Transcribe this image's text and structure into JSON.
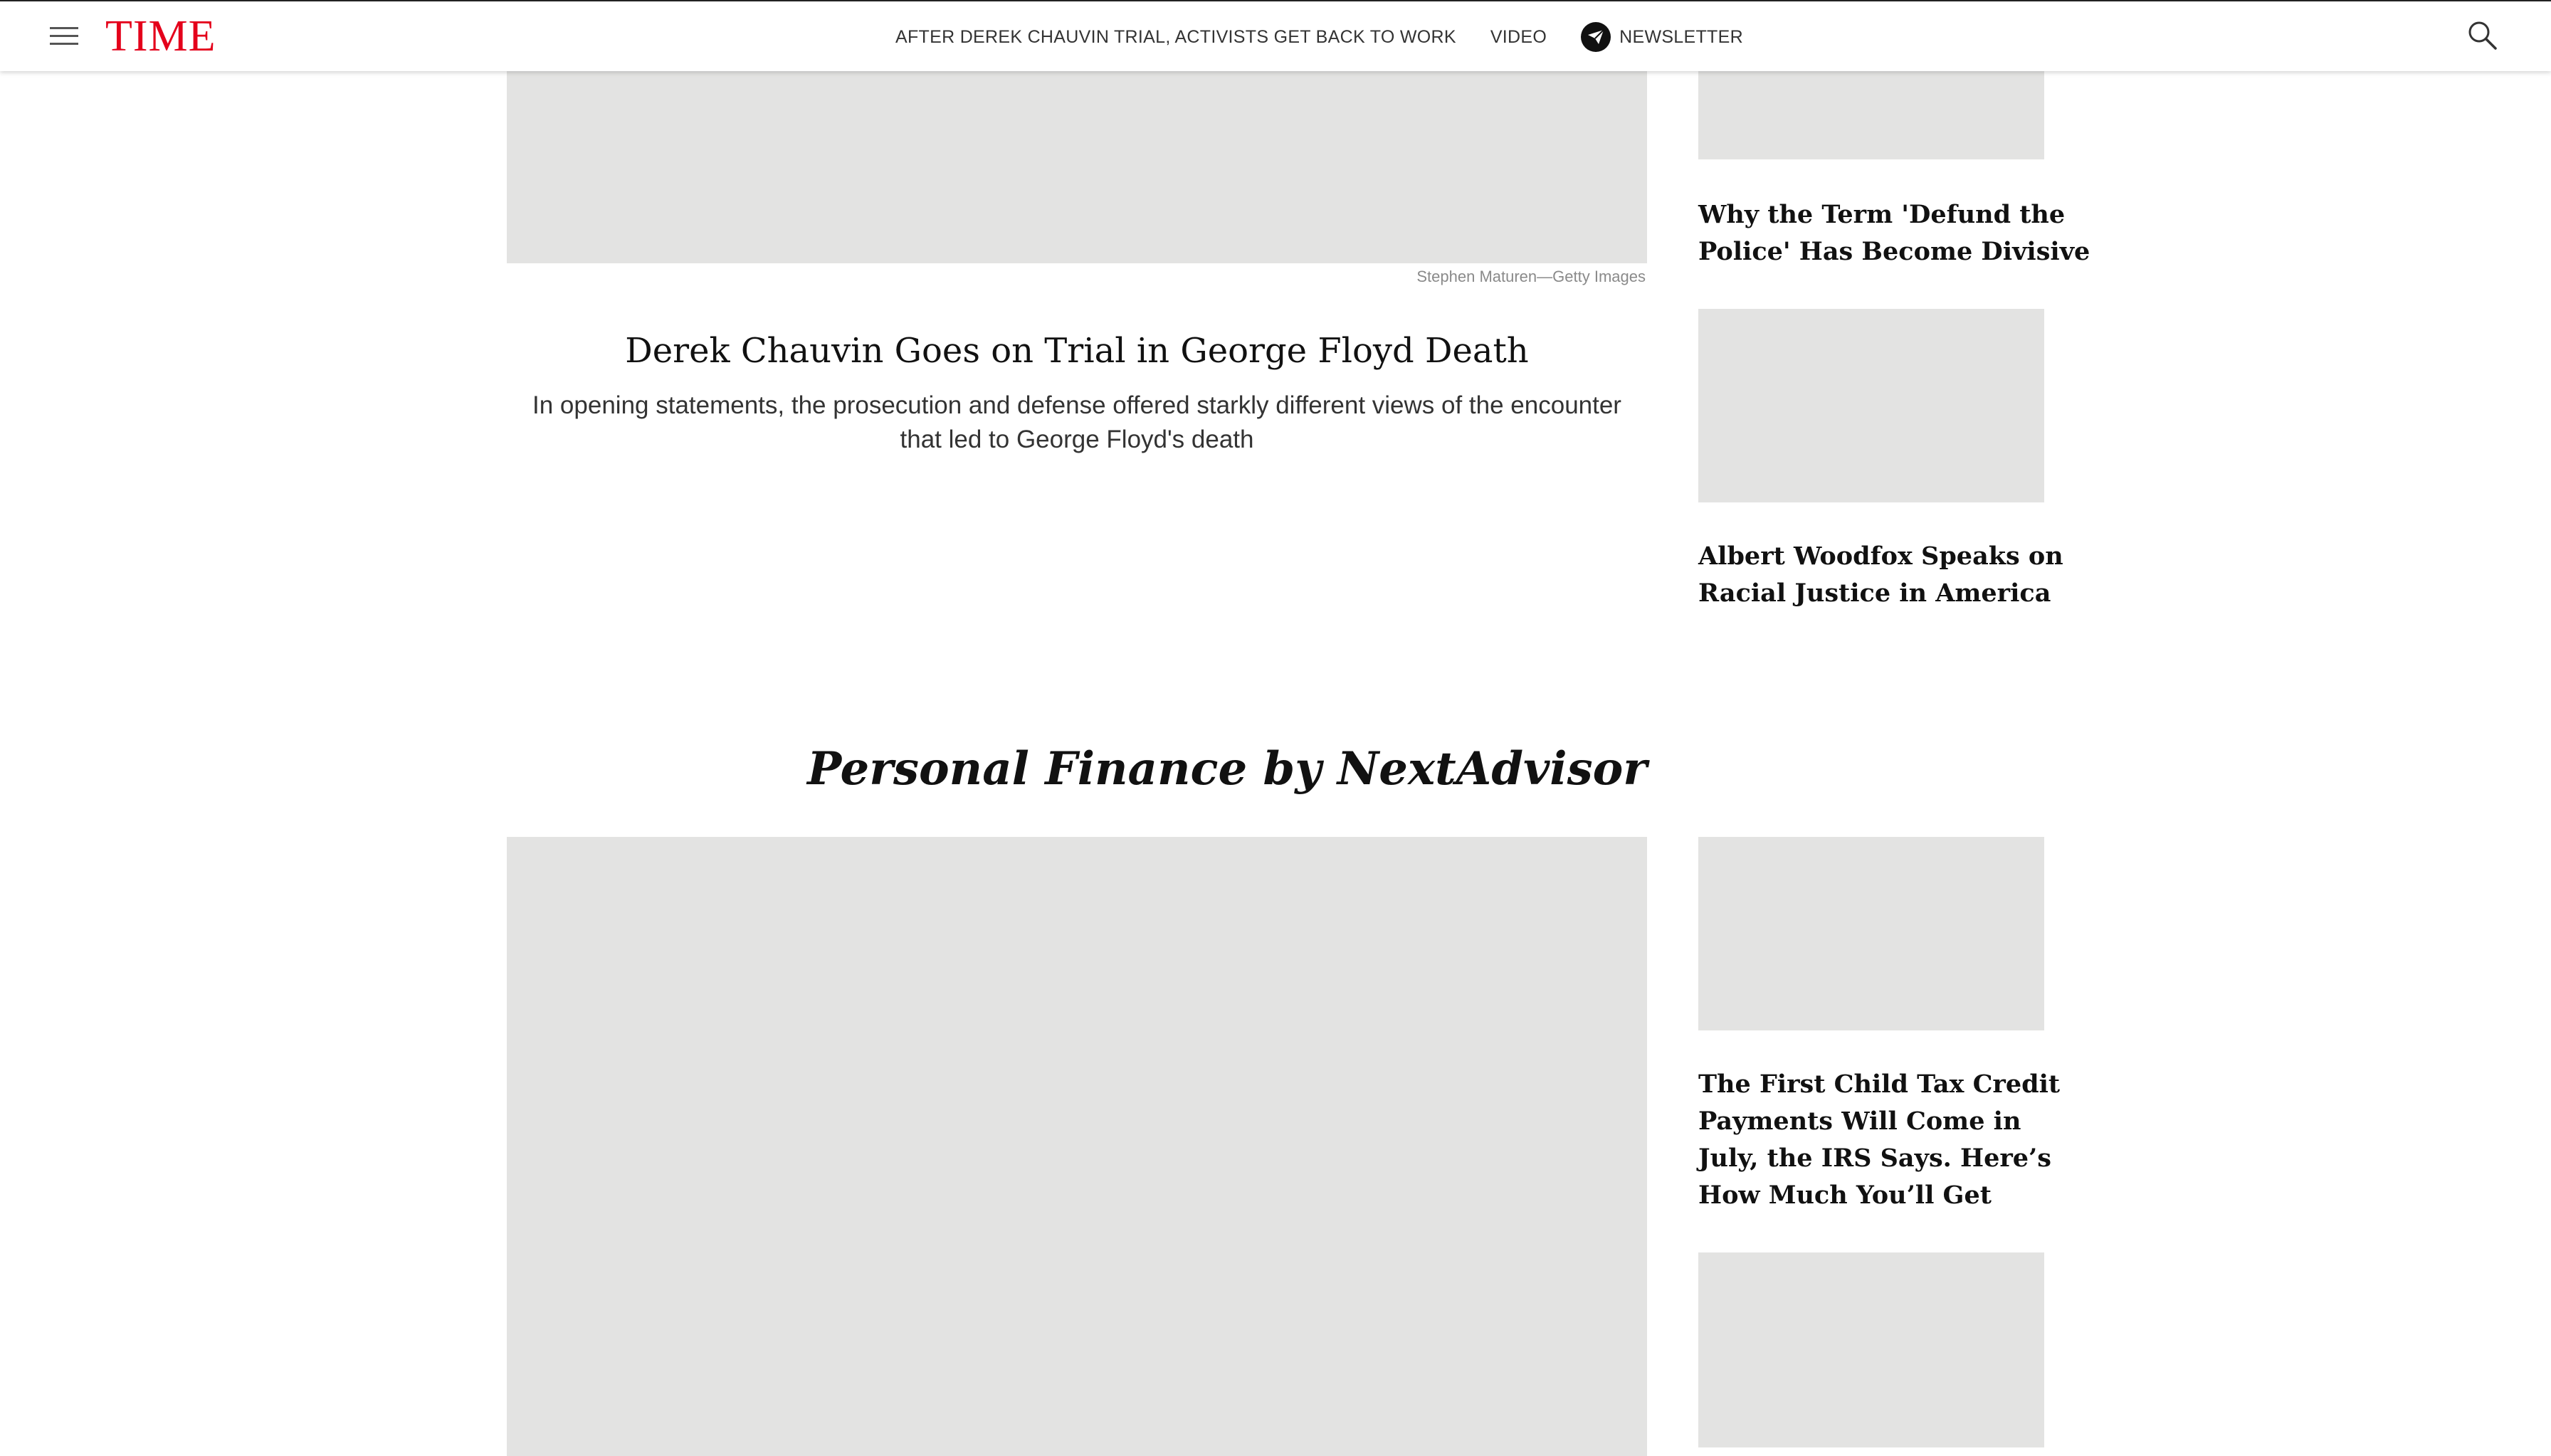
{
  "nav": {
    "logo": "TIME",
    "links": [
      "AFTER DEREK CHAUVIN TRIAL, ACTIVISTS GET BACK TO WORK",
      "VIDEO",
      "NEWSLETTER"
    ],
    "icons": [
      "menu-icon",
      "newsletter-icon",
      "search-icon"
    ],
    "logo_color": "#e4001b"
  },
  "hero": {
    "caption": "Stephen Maturen—Getty Images",
    "title": "Derek Chauvin Goes on Trial in George Floyd Death",
    "description_lines": [
      "In opening statements, the prosecution and defense offered starkly different views of the encounter",
      "that led to George Floyd's death"
    ]
  },
  "sidebar": {
    "items": [
      {
        "title_lines": [
          "Why the Term 'Defund the",
          "Police' Has Become Divisive"
        ]
      },
      {
        "title_lines": [
          "Albert Woodfox Speaks on",
          "Racial Justice in America"
        ]
      },
      {
        "title_lines": [
          "The First Child Tax Credit",
          "Payments Will Come in",
          "July, the IRS Says. Here’s",
          "How Much You’ll Get"
        ]
      }
    ]
  },
  "section": {
    "heading": "Personal Finance by NextAdvisor"
  },
  "colors": {
    "placeholder": "#e3e3e2",
    "text": "#111111"
  }
}
